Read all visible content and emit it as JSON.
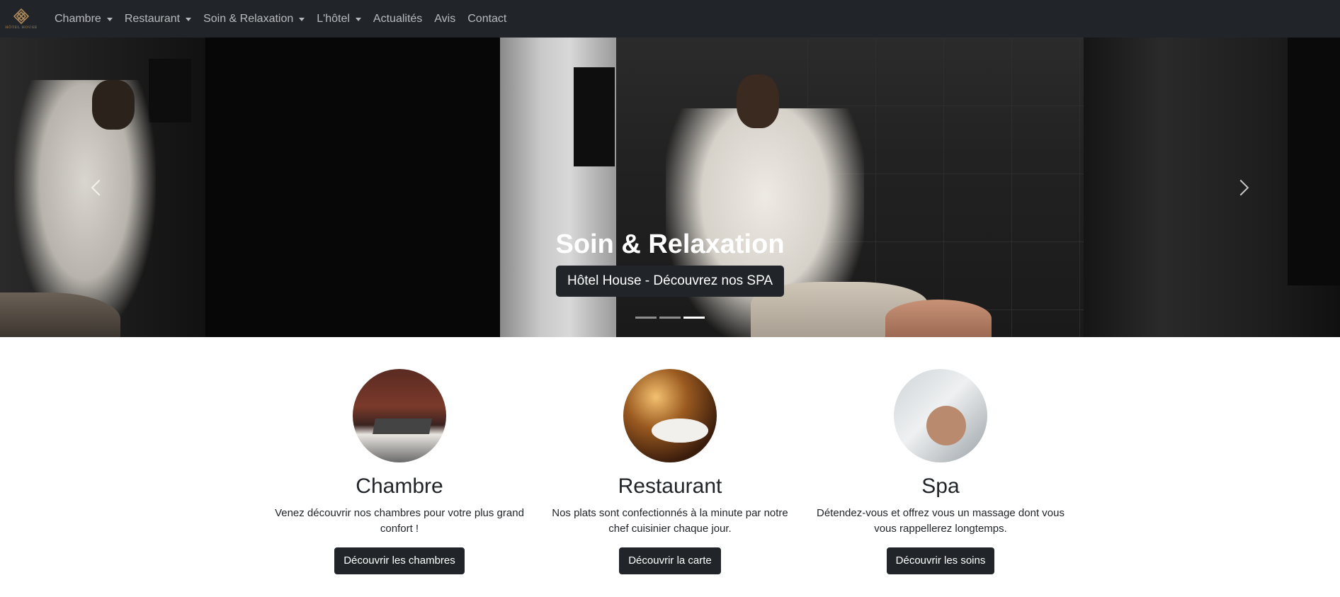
{
  "brand": {
    "text": "HÔTEL HOUSE",
    "logo_color": "#b08a5a"
  },
  "nav": {
    "items": [
      {
        "label": "Chambre",
        "dropdown": true
      },
      {
        "label": "Restaurant",
        "dropdown": true
      },
      {
        "label": "Soin & Relaxation",
        "dropdown": true
      },
      {
        "label": "L'hôtel",
        "dropdown": true
      },
      {
        "label": "Actualités",
        "dropdown": false
      },
      {
        "label": "Avis",
        "dropdown": false
      },
      {
        "label": "Contact",
        "dropdown": false
      }
    ]
  },
  "carousel": {
    "title": "Soin & Relaxation",
    "subtitle": "Hôtel House - Découvrez nos SPA",
    "slide_count": 3,
    "active_slide": 3,
    "prev_icon": "chevron-left-icon",
    "next_icon": "chevron-right-icon"
  },
  "features": [
    {
      "title": "Chambre",
      "text": "Venez découvrir nos chambres pour votre plus grand confort !",
      "button": "Découvrir les chambres",
      "image": "hotel-room"
    },
    {
      "title": "Restaurant",
      "text": "Nos plats sont confectionnés à la minute par notre chef cuisinier chaque jour.",
      "button": "Découvrir la carte",
      "image": "restaurant-dishes"
    },
    {
      "title": "Spa",
      "text": "Détendez-vous et offrez vous un massage dont vous vous rappellerez longtemps.",
      "button": "Découvrir les soins",
      "image": "spa-massage"
    }
  ],
  "colors": {
    "navbar": "#212529",
    "button": "#212529",
    "accent_gold": "#b08a5a"
  }
}
